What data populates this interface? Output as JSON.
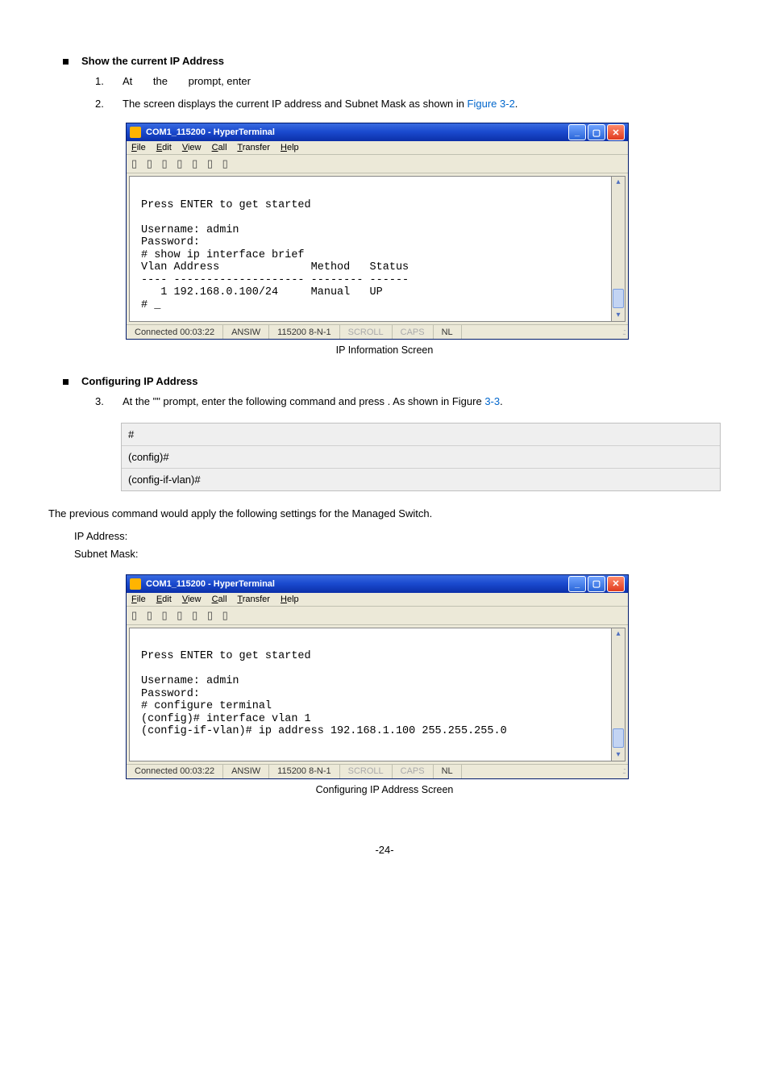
{
  "section1": {
    "bullet": "Show the current IP Address",
    "step1": {
      "num": "1.",
      "p1": "At",
      "p2": "the",
      "p3": "prompt, enter"
    },
    "step2": {
      "num": "2.",
      "text_a": "The screen displays the current IP address and Subnet Mask as shown in ",
      "ref": "Figure 3-2",
      "text_b": "."
    }
  },
  "ht1": {
    "title": "COM1_115200 - HyperTerminal",
    "term": "\nPress ENTER to get started\n\nUsername: admin\nPassword:\n# show ip interface brief\nVlan Address              Method   Status\n---- -------------------- -------- ------\n   1 192.168.0.100/24     Manual   UP\n# _"
  },
  "caption1": "IP Information Screen",
  "section2": {
    "bullet": "Configuring IP Address",
    "step3": {
      "num": "3.",
      "text_a": "At the \"",
      "text_b": "\" prompt, enter the following command and press ",
      "text_c": ". As shown in Figure ",
      "ref": "3-3",
      "text_d": "."
    }
  },
  "cmdbox": {
    "l1": "#",
    "l2": "(config)#",
    "l3": "(config-if-vlan)#"
  },
  "intro2": "The previous command would apply the following settings for the Managed Switch.",
  "settings": {
    "ip": "IP Address:",
    "mask": "Subnet Mask:"
  },
  "ht2": {
    "title": "COM1_115200 - HyperTerminal",
    "term": "\nPress ENTER to get started\n\nUsername: admin\nPassword:\n# configure terminal\n(config)# interface vlan 1\n(config-if-vlan)# ip address 192.168.1.100 255.255.255.0"
  },
  "caption2": "Configuring IP Address Screen",
  "pagenum": "-24-",
  "ht_common": {
    "menu": {
      "file": "File",
      "edit": "Edit",
      "view": "View",
      "call": "Call",
      "transfer": "Transfer",
      "help": "Help"
    },
    "toolbar": "▯ ▯  ▯ ▯  ▯ ▯  ▯",
    "status": {
      "conn": "Connected 00:03:22",
      "auto": "ANSIW",
      "cfg": "115200 8-N-1",
      "scroll": "SCROLL",
      "caps": "CAPS",
      "nl": "NL"
    },
    "btn_min": "_",
    "btn_max": "▢",
    "btn_close": "✕",
    "arr_up": "▴",
    "arr_dn": "▾",
    "grip": ".::"
  }
}
